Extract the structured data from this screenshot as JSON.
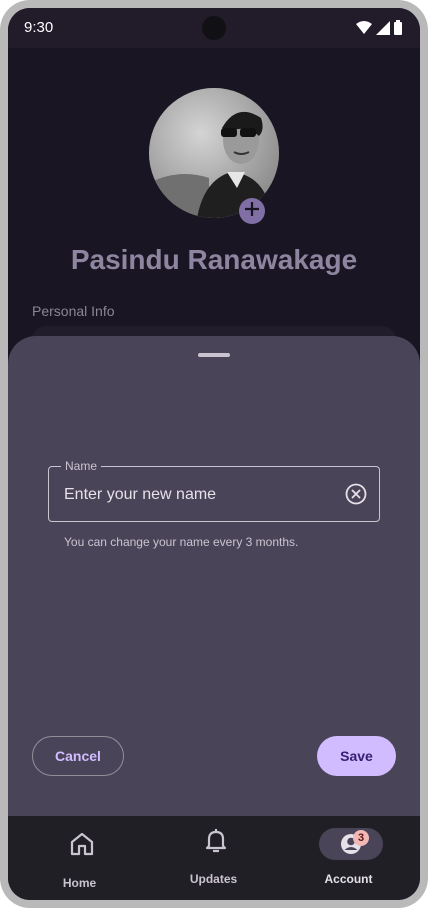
{
  "status_bar": {
    "time": "9:30",
    "icons": [
      "wifi-icon",
      "signal-icon",
      "battery-icon"
    ]
  },
  "profile": {
    "name": "Pasindu Ranawakage",
    "avatar_add_icon": "plus-icon"
  },
  "section": {
    "personal_info_label": "Personal Info"
  },
  "sheet": {
    "name_field": {
      "label": "Name",
      "placeholder": "Enter your new name",
      "value": "",
      "clear_icon": "clear-circle-icon"
    },
    "supporting_text": "You can change your name every 3 months.",
    "cancel_label": "Cancel",
    "save_label": "Save"
  },
  "nav": {
    "items": [
      {
        "label": "Home",
        "icon": "home-icon",
        "active": false
      },
      {
        "label": "Updates",
        "icon": "bell-icon",
        "active": false
      },
      {
        "label": "Account",
        "icon": "account-icon",
        "active": true,
        "badge": "3"
      }
    ]
  },
  "colors": {
    "accent": "#d0bcff",
    "sheet_bg": "#4a4458",
    "screen_bg": "#17131f",
    "name_color": "#8e86a1"
  }
}
